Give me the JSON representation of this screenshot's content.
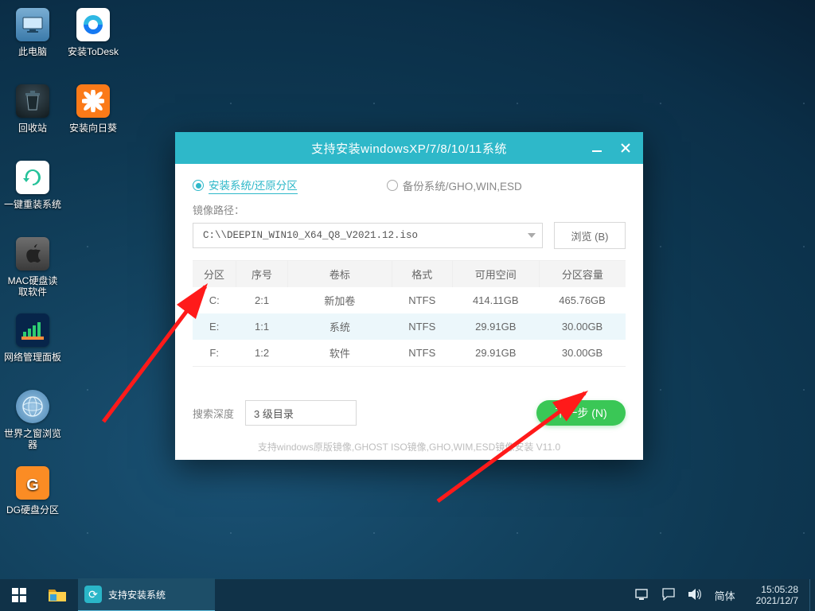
{
  "desktop": {
    "icons_col1": [
      {
        "id": "this-pc",
        "label": "此电脑"
      },
      {
        "id": "recycle-bin",
        "label": "回收站"
      },
      {
        "id": "one-click-reinstall",
        "label": "一键重装系统"
      },
      {
        "id": "mac-disk-reader",
        "label": "MAC硬盘读取软件"
      },
      {
        "id": "network-panel",
        "label": "网络管理面板"
      },
      {
        "id": "theworld-browser",
        "label": "世界之窗浏览器"
      },
      {
        "id": "dg-partition",
        "label": "DG硬盘分区"
      }
    ],
    "icons_col2": [
      {
        "id": "install-todesk",
        "label": "安装ToDesk"
      },
      {
        "id": "install-sunflower",
        "label": "安装向日葵"
      }
    ]
  },
  "dialog": {
    "title": "支持安装windowsXP/7/8/10/11系统",
    "mode_install": "安装系统/还原分区",
    "mode_backup": "备份系统/GHO,WIN,ESD",
    "image_path_label": "镜像路径：",
    "image_path_value": "C:\\\\DEEPIN_WIN10_X64_Q8_V2021.12.iso",
    "browse_label": "浏览 (B)",
    "columns": [
      "分区",
      "序号",
      "卷标",
      "格式",
      "可用空间",
      "分区容量"
    ],
    "rows": [
      {
        "part": "C:",
        "index": "2:1",
        "label": "新加卷",
        "fs": "NTFS",
        "free": "414.11GB",
        "total": "465.76GB",
        "selected": false
      },
      {
        "part": "E:",
        "index": "1:1",
        "label": "系统",
        "fs": "NTFS",
        "free": "29.91GB",
        "total": "30.00GB",
        "selected": true
      },
      {
        "part": "F:",
        "index": "1:2",
        "label": "软件",
        "fs": "NTFS",
        "free": "29.91GB",
        "total": "30.00GB",
        "selected": false
      }
    ],
    "depth_label": "搜索深度",
    "depth_value": "3 级目录",
    "next_label": "下一步 (N)",
    "support_hint": "支持windows原版镜像,GHOST ISO镜像,GHO,WIM,ESD镜像安装  V11.0"
  },
  "taskbar": {
    "active_task": "支持安装系统",
    "ime": "简体",
    "clock_time": "15:05:28",
    "clock_date": "2021/12/7"
  },
  "colors": {
    "teal": "#2eb8c9",
    "green": "#3ac756",
    "taskbar": "#103248"
  }
}
